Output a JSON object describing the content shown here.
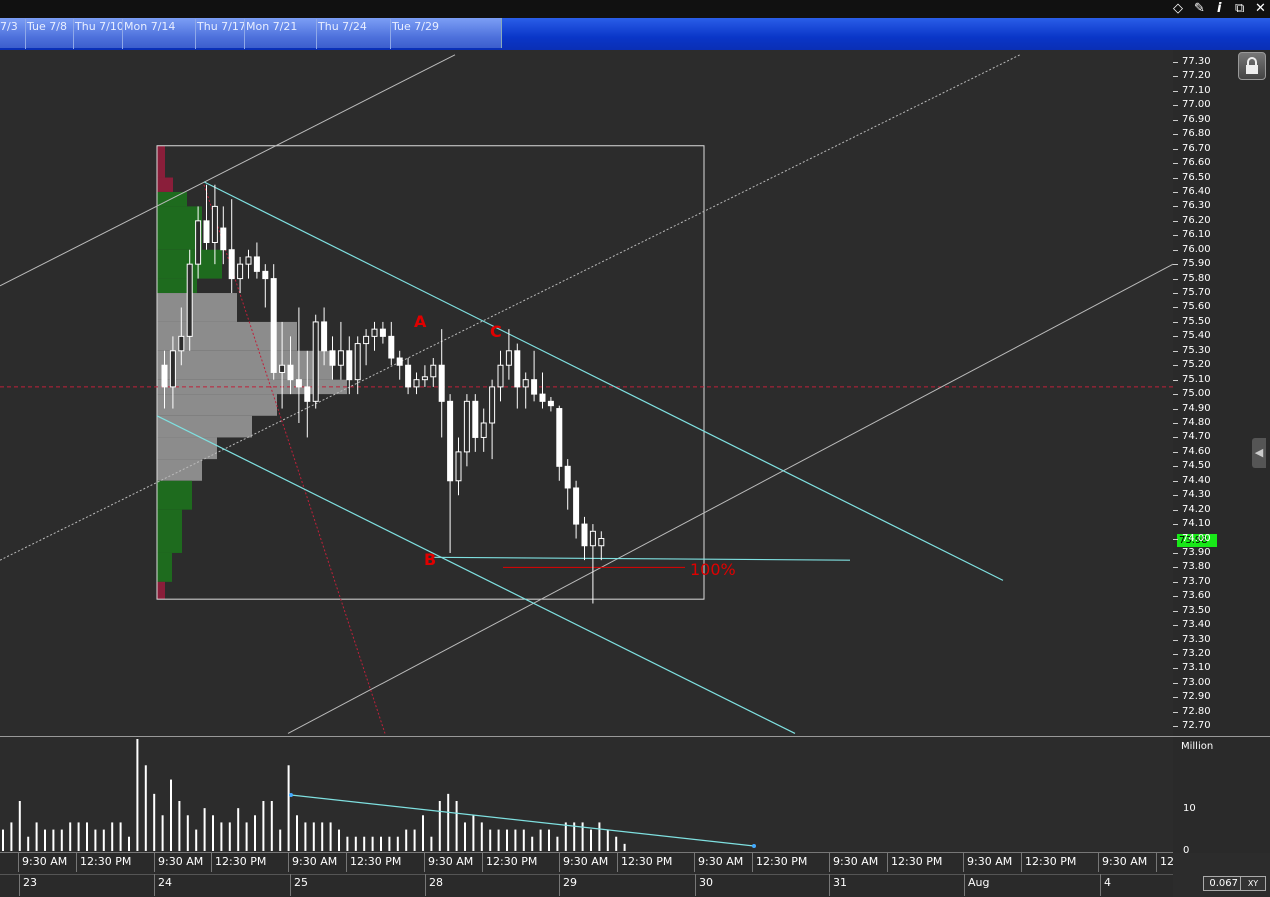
{
  "navigator": {
    "labels": [
      "7/3",
      "Tue 7/8",
      "Thu 7/10",
      "Mon 7/14",
      "Thu 7/17",
      "Mon 7/21",
      "Thu 7/24",
      "Tue 7/29"
    ]
  },
  "toolbar": {
    "icons": [
      "diamond-icon",
      "pin-icon",
      "info-icon",
      "restore-window-icon",
      "close-icon"
    ],
    "info_glyph": "i",
    "close_glyph": "✕"
  },
  "annotations": {
    "a": "A",
    "b": "B",
    "c": "C",
    "fib": "100%"
  },
  "current_price": "73.98",
  "volume_axis": {
    "unit": "Million",
    "ticks": [
      "10",
      "0"
    ]
  },
  "time_axis": {
    "row1": [
      "9:30 AM",
      "12:30 PM",
      "9:30 AM",
      "12:30 PM",
      "9:30 AM",
      "12:30 PM",
      "9:30 AM",
      "12:30 PM",
      "9:30 AM",
      "12:30 PM",
      "9:30 AM",
      "12:30 PM",
      "9:30 AM",
      "12:30 PM",
      "9:30 AM",
      "12:30 PM",
      "9:30 AM",
      "12"
    ],
    "row2": [
      "23",
      "24",
      "25",
      "28",
      "29",
      "30",
      "31",
      "Aug",
      "4"
    ]
  },
  "zoom": {
    "value": "0.067",
    "xy_label": "XY"
  },
  "colors": {
    "background": "#2c2c2c",
    "up_candle": "#ffffff",
    "channel": "#7fe0e0",
    "annotation": "#e00000",
    "last_price": "#18e818",
    "vp_buy": "#1e6b1e",
    "vp_sell": "#8a1e3a",
    "vp_value": "#8c8c8c"
  },
  "chart_data": {
    "type": "candlestick",
    "price_axis": {
      "ticks": [
        "77.30",
        "77.20",
        "77.10",
        "77.00",
        "76.90",
        "76.80",
        "76.70",
        "76.60",
        "76.50",
        "76.40",
        "76.30",
        "76.20",
        "76.10",
        "76.00",
        "75.90",
        "75.80",
        "75.70",
        "75.60",
        "75.50",
        "75.40",
        "75.30",
        "75.20",
        "75.10",
        "75.00",
        "74.90",
        "74.80",
        "74.70",
        "74.60",
        "74.50",
        "74.40",
        "74.30",
        "74.20",
        "74.10",
        "74.00",
        "73.90",
        "73.80",
        "73.70",
        "73.60",
        "73.50",
        "73.40",
        "73.30",
        "73.20",
        "73.10",
        "73.00",
        "72.90",
        "72.80",
        "72.70"
      ],
      "range": [
        72.65,
        77.35
      ]
    },
    "last_price": 73.98,
    "reference_line": 75.05,
    "candles": [
      {
        "o": 75.2,
        "h": 75.3,
        "l": 74.9,
        "c": 75.05
      },
      {
        "o": 75.05,
        "h": 75.4,
        "l": 74.9,
        "c": 75.3
      },
      {
        "o": 75.3,
        "h": 75.6,
        "l": 75.2,
        "c": 75.4
      },
      {
        "o": 75.4,
        "h": 76.0,
        "l": 75.3,
        "c": 75.9
      },
      {
        "o": 75.9,
        "h": 76.3,
        "l": 75.8,
        "c": 76.2
      },
      {
        "o": 76.2,
        "h": 76.45,
        "l": 76.0,
        "c": 76.05
      },
      {
        "o": 76.05,
        "h": 76.45,
        "l": 75.9,
        "c": 76.3
      },
      {
        "o": 76.15,
        "h": 76.3,
        "l": 75.9,
        "c": 76.0
      },
      {
        "o": 76.0,
        "h": 76.35,
        "l": 75.7,
        "c": 75.8
      },
      {
        "o": 75.8,
        "h": 75.95,
        "l": 75.7,
        "c": 75.9
      },
      {
        "o": 75.9,
        "h": 76.0,
        "l": 75.8,
        "c": 75.95
      },
      {
        "o": 75.95,
        "h": 76.05,
        "l": 75.8,
        "c": 75.85
      },
      {
        "o": 75.85,
        "h": 75.9,
        "l": 75.6,
        "c": 75.8
      },
      {
        "o": 75.8,
        "h": 75.9,
        "l": 75.1,
        "c": 75.15
      },
      {
        "o": 75.15,
        "h": 75.5,
        "l": 74.9,
        "c": 75.2
      },
      {
        "o": 75.2,
        "h": 75.4,
        "l": 75.0,
        "c": 75.1
      },
      {
        "o": 75.1,
        "h": 75.6,
        "l": 74.8,
        "c": 75.05
      },
      {
        "o": 75.05,
        "h": 75.3,
        "l": 74.7,
        "c": 74.95
      },
      {
        "o": 74.95,
        "h": 75.55,
        "l": 74.9,
        "c": 75.5
      },
      {
        "o": 75.5,
        "h": 75.6,
        "l": 75.2,
        "c": 75.3
      },
      {
        "o": 75.3,
        "h": 75.4,
        "l": 75.1,
        "c": 75.2
      },
      {
        "o": 75.2,
        "h": 75.5,
        "l": 75.1,
        "c": 75.3
      },
      {
        "o": 75.3,
        "h": 75.4,
        "l": 75.0,
        "c": 75.1
      },
      {
        "o": 75.1,
        "h": 75.4,
        "l": 75.0,
        "c": 75.35
      },
      {
        "o": 75.35,
        "h": 75.45,
        "l": 75.2,
        "c": 75.4
      },
      {
        "o": 75.4,
        "h": 75.5,
        "l": 75.3,
        "c": 75.45
      },
      {
        "o": 75.45,
        "h": 75.5,
        "l": 75.35,
        "c": 75.4
      },
      {
        "o": 75.4,
        "h": 75.5,
        "l": 75.2,
        "c": 75.25
      },
      {
        "o": 75.25,
        "h": 75.3,
        "l": 75.1,
        "c": 75.2
      },
      {
        "o": 75.2,
        "h": 75.25,
        "l": 75.0,
        "c": 75.05
      },
      {
        "o": 75.05,
        "h": 75.15,
        "l": 75.0,
        "c": 75.1
      },
      {
        "o": 75.1,
        "h": 75.2,
        "l": 75.05,
        "c": 75.12
      },
      {
        "o": 75.12,
        "h": 75.25,
        "l": 75.05,
        "c": 75.2
      },
      {
        "o": 75.2,
        "h": 75.45,
        "l": 74.7,
        "c": 74.95
      },
      {
        "o": 74.95,
        "h": 75.0,
        "l": 73.9,
        "c": 74.4
      },
      {
        "o": 74.4,
        "h": 74.7,
        "l": 74.3,
        "c": 74.6
      },
      {
        "o": 74.6,
        "h": 75.0,
        "l": 74.5,
        "c": 74.95
      },
      {
        "o": 74.95,
        "h": 75.0,
        "l": 74.6,
        "c": 74.7
      },
      {
        "o": 74.7,
        "h": 74.9,
        "l": 74.6,
        "c": 74.8
      },
      {
        "o": 74.8,
        "h": 75.1,
        "l": 74.55,
        "c": 75.05
      },
      {
        "o": 75.05,
        "h": 75.3,
        "l": 74.95,
        "c": 75.2
      },
      {
        "o": 75.2,
        "h": 75.45,
        "l": 75.1,
        "c": 75.3
      },
      {
        "o": 75.3,
        "h": 75.35,
        "l": 74.9,
        "c": 75.05
      },
      {
        "o": 75.05,
        "h": 75.15,
        "l": 74.9,
        "c": 75.1
      },
      {
        "o": 75.1,
        "h": 75.3,
        "l": 74.95,
        "c": 75.0
      },
      {
        "o": 75.0,
        "h": 75.15,
        "l": 74.9,
        "c": 74.95
      },
      {
        "o": 74.95,
        "h": 74.98,
        "l": 74.88,
        "c": 74.92
      },
      {
        "o": 74.9,
        "h": 74.92,
        "l": 74.4,
        "c": 74.5
      },
      {
        "o": 74.5,
        "h": 74.55,
        "l": 74.2,
        "c": 74.35
      },
      {
        "o": 74.35,
        "h": 74.4,
        "l": 74.0,
        "c": 74.1
      },
      {
        "o": 74.1,
        "h": 74.15,
        "l": 73.85,
        "c": 73.95
      },
      {
        "o": 73.95,
        "h": 74.1,
        "l": 73.55,
        "c": 74.05
      },
      {
        "o": 73.95,
        "h": 74.05,
        "l": 73.85,
        "c": 74.0
      }
    ],
    "volume_bars": [
      3,
      4,
      7,
      2,
      4,
      3,
      3,
      3,
      4,
      4,
      4,
      3,
      3,
      4,
      4,
      2,
      40,
      12,
      8,
      5,
      10,
      7,
      5,
      3,
      6,
      5,
      4,
      4,
      6,
      4,
      5,
      7,
      7,
      3,
      12,
      5,
      4,
      4,
      4,
      4,
      3,
      2,
      2,
      2,
      2,
      2,
      2,
      2,
      3,
      3,
      5,
      2,
      7,
      8,
      7,
      4,
      5,
      4,
      3,
      3,
      3,
      3,
      3,
      2,
      3,
      3,
      2,
      4,
      4,
      4,
      3,
      4,
      3,
      2,
      1
    ],
    "volume_range": [
      0,
      14
    ]
  }
}
